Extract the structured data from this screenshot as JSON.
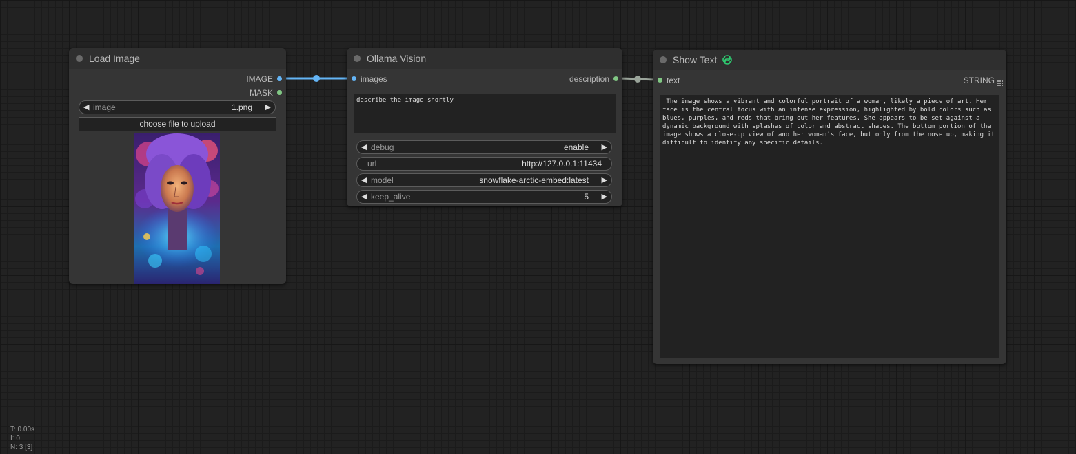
{
  "canvas": {
    "link_color_image": "#64b5f6",
    "link_color_string": "#9aa49a",
    "node_bg": "#353535"
  },
  "nodes": {
    "load_image": {
      "title": "Load Image",
      "outputs": [
        {
          "label": "IMAGE",
          "color": "#64b5f6"
        },
        {
          "label": "MASK",
          "color": "#81c784"
        }
      ],
      "widgets": {
        "image": {
          "label": "image",
          "value": "1.png"
        },
        "upload_label": "choose file to upload"
      }
    },
    "ollama_vision": {
      "title": "Ollama Vision",
      "inputs": [
        {
          "label": "images",
          "color": "#64b5f6"
        }
      ],
      "outputs": [
        {
          "label": "description",
          "color": "#81c784"
        }
      ],
      "prompt": "describe the image shortly",
      "widgets": [
        {
          "label": "debug",
          "value": "enable"
        },
        {
          "label": "url",
          "value": "http://127.0.0.1:11434"
        },
        {
          "label": "model",
          "value": "snowflake-arctic-embed:latest"
        },
        {
          "label": "keep_alive",
          "value": "5"
        }
      ]
    },
    "show_text": {
      "title": "Show Text",
      "title_icon": "python-snake-icon",
      "title_icon_color": "#2ecc71",
      "inputs": [
        {
          "label": "text",
          "color": "#81c784"
        }
      ],
      "outputs": [
        {
          "label": "STRING",
          "icon": "list-grid-icon"
        }
      ],
      "text": " The image shows a vibrant and colorful portrait of a woman, likely a piece of art. Her face is the central focus with an intense expression, highlighted by bold colors such as blues, purples, and reds that bring out her features. She appears to be set against a dynamic background with splashes of color and abstract shapes. The bottom portion of the image shows a close-up view of another woman's face, but only from the nose up, making it difficult to identify any specific details."
    }
  },
  "stats": {
    "time": "T: 0.00s",
    "iterations": "I: 0",
    "nodes": "N: 3 [3]"
  }
}
